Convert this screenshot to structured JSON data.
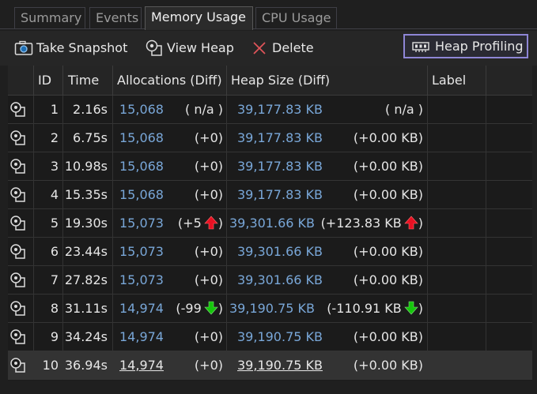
{
  "tabs": [
    {
      "label": "Summary",
      "active": false
    },
    {
      "label": "Events",
      "active": false
    },
    {
      "label": "Memory Usage",
      "active": true
    },
    {
      "label": "CPU Usage",
      "active": false
    }
  ],
  "toolbar": {
    "take_snapshot": "Take Snapshot",
    "view_heap": "View Heap",
    "delete": "Delete",
    "heap_profiling": "Heap Profiling"
  },
  "columns": {
    "id": "ID",
    "time": "Time",
    "allocations": "Allocations (Diff)",
    "heap_size": "Heap Size (Diff)",
    "label": "Label"
  },
  "colors": {
    "accent_border": "#8e86d6",
    "link_blue": "#79a7d8",
    "arrow_up": "#e81123",
    "arrow_down": "#16c60c"
  },
  "rows": [
    {
      "id": "1",
      "time": "2.16s",
      "alloc": "15,068",
      "alloc_diff": "( n/a )",
      "heap": "39,177.83 KB",
      "heap_diff": "( n/a )",
      "trend": "none"
    },
    {
      "id": "2",
      "time": "6.75s",
      "alloc": "15,068",
      "alloc_diff": "(+0)",
      "heap": "39,177.83 KB",
      "heap_diff": "(+0.00 KB)",
      "trend": "none"
    },
    {
      "id": "3",
      "time": "10.98s",
      "alloc": "15,068",
      "alloc_diff": "(+0)",
      "heap": "39,177.83 KB",
      "heap_diff": "(+0.00 KB)",
      "trend": "none"
    },
    {
      "id": "4",
      "time": "15.35s",
      "alloc": "15,068",
      "alloc_diff": "(+0)",
      "heap": "39,177.83 KB",
      "heap_diff": "(+0.00 KB)",
      "trend": "none"
    },
    {
      "id": "5",
      "time": "19.30s",
      "alloc": "15,073",
      "alloc_diff": "(+5",
      "heap": "39,301.66 KB",
      "heap_diff": "(+123.83 KB",
      "trend": "up"
    },
    {
      "id": "6",
      "time": "23.44s",
      "alloc": "15,073",
      "alloc_diff": "(+0)",
      "heap": "39,301.66 KB",
      "heap_diff": "(+0.00 KB)",
      "trend": "none"
    },
    {
      "id": "7",
      "time": "27.82s",
      "alloc": "15,073",
      "alloc_diff": "(+0)",
      "heap": "39,301.66 KB",
      "heap_diff": "(+0.00 KB)",
      "trend": "none"
    },
    {
      "id": "8",
      "time": "31.11s",
      "alloc": "14,974",
      "alloc_diff": "(-99",
      "heap": "39,190.75 KB",
      "heap_diff": "(-110.91 KB",
      "trend": "down"
    },
    {
      "id": "9",
      "time": "34.24s",
      "alloc": "14,974",
      "alloc_diff": "(+0)",
      "heap": "39,190.75 KB",
      "heap_diff": "(+0.00 KB)",
      "trend": "none"
    },
    {
      "id": "10",
      "time": "36.94s",
      "alloc": "14,974",
      "alloc_diff": "(+0)",
      "heap": "39,190.75 KB",
      "heap_diff": "(+0.00 KB)",
      "trend": "none",
      "selected": true
    }
  ]
}
